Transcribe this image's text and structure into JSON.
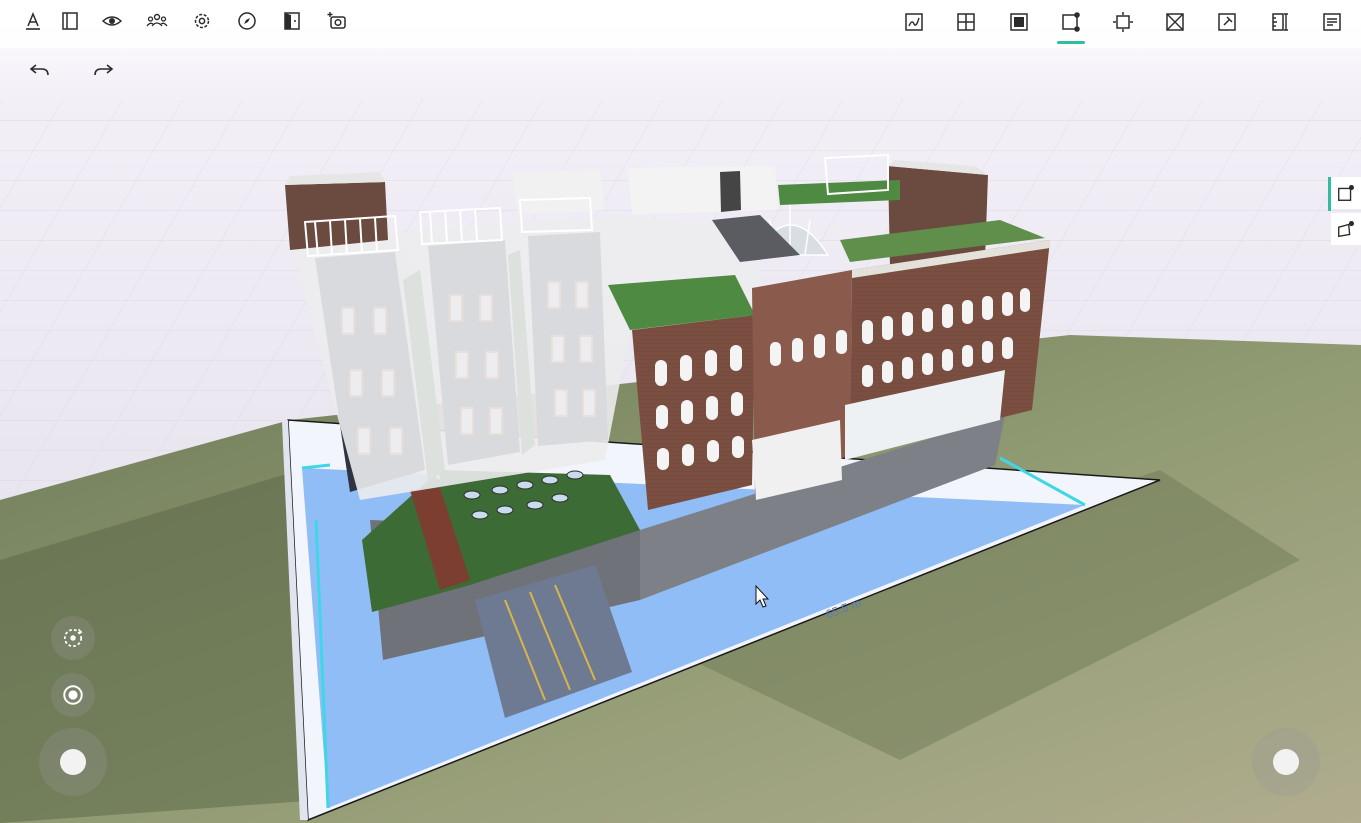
{
  "scene": {
    "dimension_label": "65.5 m"
  },
  "toolbar_left": [
    {
      "icon": "pencil-underline-icon"
    },
    {
      "icon": "wall-panel-icon"
    },
    {
      "icon": "eye-icon"
    },
    {
      "icon": "people-icon"
    },
    {
      "icon": "gear-icon"
    },
    {
      "icon": "compass-icon"
    },
    {
      "icon": "door-icon"
    },
    {
      "icon": "camera-sparkle-icon"
    }
  ],
  "toolbar_right": [
    {
      "icon": "sketch-frame-icon"
    },
    {
      "icon": "window-grid-icon"
    },
    {
      "icon": "filled-square-icon"
    },
    {
      "icon": "square-corner-nodes-icon",
      "active": true
    },
    {
      "icon": "square-arrows-icon"
    },
    {
      "icon": "crossed-square-icon"
    },
    {
      "icon": "pin-square-icon"
    },
    {
      "icon": "ruler-panel-icon"
    },
    {
      "icon": "list-panel-icon"
    }
  ],
  "colors": {
    "accent": "#2fbfa0",
    "icon": "#2b2b2b",
    "ground": "#8e9870",
    "floor_plan": "#90bdf5"
  }
}
